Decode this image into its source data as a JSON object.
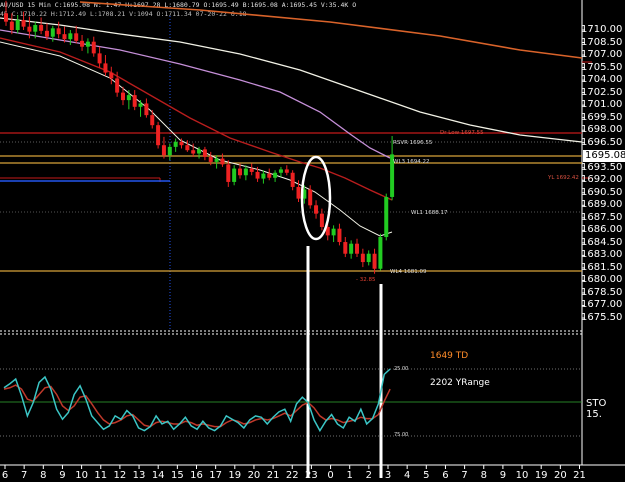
{
  "header": {
    "line1": "AU/USD 15 Min C:1695.08 N: 1.47 H:1697.28 L:1680.79 O:1695.49 B:1695.08 A:1695.45 V:35.4K O",
    "line2": "45 C:1710.22 H:1712.49 L:1708.21 V:1094 O:1711.34 07-20-22 6:18"
  },
  "price_axis": [
    "1710.00",
    "1708.50",
    "1707.00",
    "1705.50",
    "1704.00",
    "1702.50",
    "1701.00",
    "1699.50",
    "1698.00",
    "1696.50",
    "1693.50",
    "1692.00",
    "1690.50",
    "1689.00",
    "1687.50",
    "1686.00",
    "1684.50",
    "1683.00",
    "1681.50",
    "1680.00",
    "1678.50",
    "1677.00",
    "1675.50"
  ],
  "current_price": "1695.08",
  "levels": {
    "dr_low": "Dr Low 1697.55",
    "rsvr": "RSVR 1696.55",
    "wl3": "WL3 1694.22",
    "yl": "YL 1692.42",
    "wl1": "WL1 1688.17",
    "wl4": "WL4 1681.09",
    "minus": "- 32.85"
  },
  "indicator": {
    "td_label": "1649 TD",
    "yrange_label": "2202 YRange",
    "sto_label": "STO 15.",
    "level_25": "25.00",
    "level_75": "75.00"
  },
  "x_axis": [
    "6",
    "7",
    "8",
    "9",
    "10",
    "11",
    "12",
    "13",
    "14",
    "15",
    "16",
    "17",
    "19",
    "20",
    "21",
    "22",
    "23",
    "0",
    "1",
    "2",
    "3",
    "4",
    "5",
    "6",
    "7",
    "8",
    "9",
    "10",
    "19",
    "20",
    "21"
  ],
  "colors": {
    "background": "#000000",
    "candle_up": "#22cc22",
    "candle_down": "#ee2222",
    "orange_ma": "#d9632a",
    "white_ma": "#f2f2e6",
    "violet_ma": "#c58fd8",
    "red_ma": "#b81d1d",
    "level_red": "#c41a1a",
    "level_gold": "#d8a23a",
    "level_blue": "#2255ee",
    "stoch_cyan": "#3bc6c6",
    "stoch_red": "#c0392b"
  }
}
